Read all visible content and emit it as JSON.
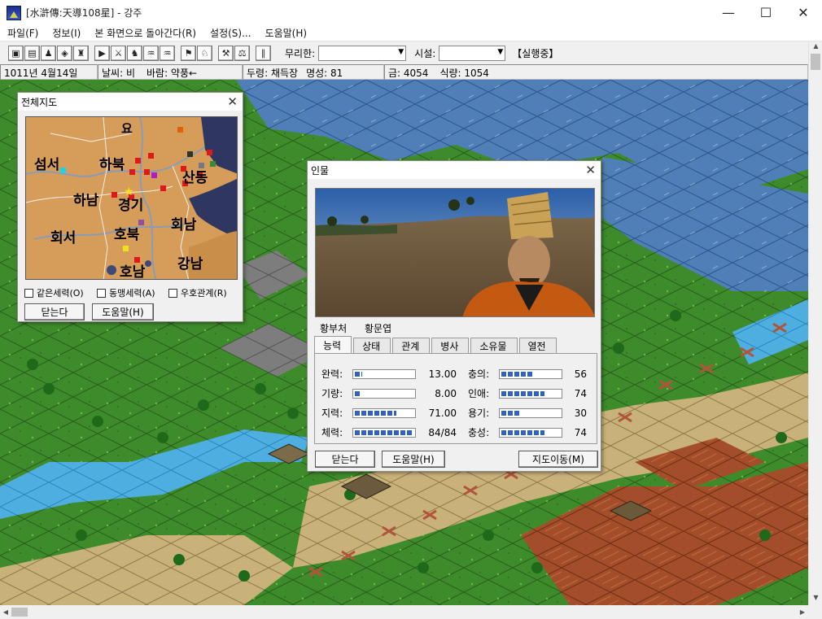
{
  "window": {
    "title": "[水滸傳:天導108星]  -  강주",
    "minimize": "—",
    "maximize": "☐",
    "close": "✕"
  },
  "menu": [
    "파일(F)",
    "정보(I)",
    "본 화면으로 돌아간다(R)",
    "설정(S)...",
    "도움말(H)"
  ],
  "toolbar": {
    "group1": [
      "▣",
      "▤",
      "♟",
      "◈",
      "♜"
    ],
    "group2": [
      "▶",
      "⚔",
      "♞",
      "♒",
      "♒"
    ],
    "group3": [
      "⚑",
      "♘"
    ],
    "group4": [
      "⚒",
      "⚖"
    ],
    "group5": [
      "∥"
    ],
    "muri_label": "무리한:",
    "facility_label": "시설:",
    "status": "【실행중】"
  },
  "statusbar": {
    "date": "1011년 4월14일",
    "weather": "날씨: 비",
    "wind": "바람: 약풍←",
    "leader": "두령: 채득장",
    "fame": "명성: 81",
    "gold": "금: 4054",
    "food": "식량: 1054"
  },
  "world_map": {
    "title": "전체지도",
    "close": "✕",
    "regions": [
      "요",
      "섬서",
      "하북",
      "산동",
      "하남",
      "경기",
      "회서",
      "호북",
      "회남",
      "강남",
      "호남"
    ],
    "checkboxes": [
      "같은세력(O)",
      "동맹세력(A)",
      "우호관계(R)"
    ],
    "close_button": "닫는다",
    "help_button": "도움말(H)",
    "colors": {
      "land": "#d69d5a",
      "river": "#8a9bb8",
      "sea": "#2f3760",
      "marker_red": "#e01818",
      "marker_cyan": "#22d0e0",
      "marker_purple": "#b020c0",
      "marker_yellow": "#f0e020"
    }
  },
  "person": {
    "title": "인물",
    "close": "✕",
    "names": [
      "황부처",
      "황문엽"
    ],
    "tabs": [
      "능력",
      "상태",
      "관계",
      "병사",
      "소유물",
      "열전"
    ],
    "stats_left": [
      {
        "label": "완력:",
        "value": "13.00",
        "fill": 0.13
      },
      {
        "label": "기량:",
        "value": "8.00",
        "fill": 0.08
      },
      {
        "label": "지력:",
        "value": "71.00",
        "fill": 0.71
      },
      {
        "label": "체력:",
        "value": "84/84",
        "fill": 1.0
      }
    ],
    "stats_right": [
      {
        "label": "충의:",
        "value": "56",
        "fill": 0.56
      },
      {
        "label": "인애:",
        "value": "74",
        "fill": 0.74
      },
      {
        "label": "용기:",
        "value": "30",
        "fill": 0.3
      },
      {
        "label": "충성:",
        "value": "74",
        "fill": 0.74
      }
    ],
    "close_button": "닫는다",
    "help_button": "도움말(H)",
    "map_button": "지도이동(M)"
  }
}
